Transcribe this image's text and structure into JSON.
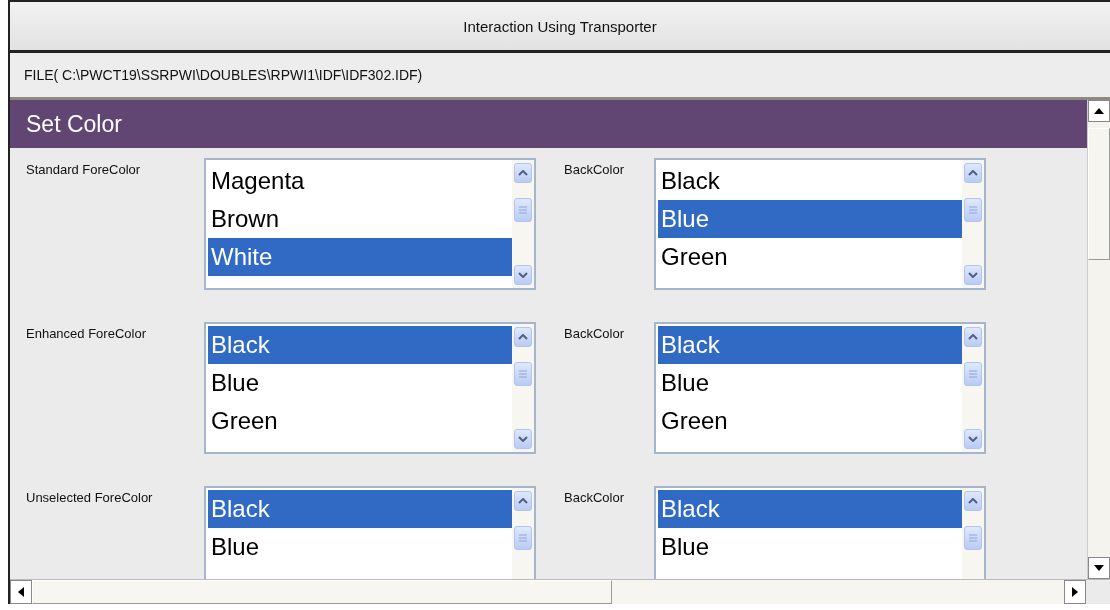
{
  "window": {
    "title": "Interaction Using Transporter"
  },
  "file_path": "FILE( C:\\PWCT19\\SSRPWI\\DOUBLES\\RPWI1\\IDF\\IDF302.IDF)",
  "panel": {
    "title": "Set Color"
  },
  "rows": [
    {
      "fore": {
        "label": "Standard ForeColor",
        "items": [
          {
            "text": "Magenta",
            "selected": false
          },
          {
            "text": "Brown",
            "selected": false
          },
          {
            "text": "White",
            "selected": true
          }
        ]
      },
      "back": {
        "label": "BackColor",
        "items": [
          {
            "text": "Black",
            "selected": false
          },
          {
            "text": "Blue",
            "selected": true
          },
          {
            "text": "Green",
            "selected": false
          }
        ]
      }
    },
    {
      "fore": {
        "label": "Enhanced ForeColor",
        "items": [
          {
            "text": "Black",
            "selected": true
          },
          {
            "text": "Blue",
            "selected": false
          },
          {
            "text": "Green",
            "selected": false
          }
        ]
      },
      "back": {
        "label": "BackColor",
        "items": [
          {
            "text": "Black",
            "selected": true
          },
          {
            "text": "Blue",
            "selected": false
          },
          {
            "text": "Green",
            "selected": false
          }
        ]
      }
    },
    {
      "fore": {
        "label": "Unselected ForeColor",
        "items": [
          {
            "text": "Black",
            "selected": true
          },
          {
            "text": "Blue",
            "selected": false
          }
        ]
      },
      "back": {
        "label": "BackColor",
        "items": [
          {
            "text": "Black",
            "selected": true
          },
          {
            "text": "Blue",
            "selected": false
          }
        ]
      }
    }
  ]
}
